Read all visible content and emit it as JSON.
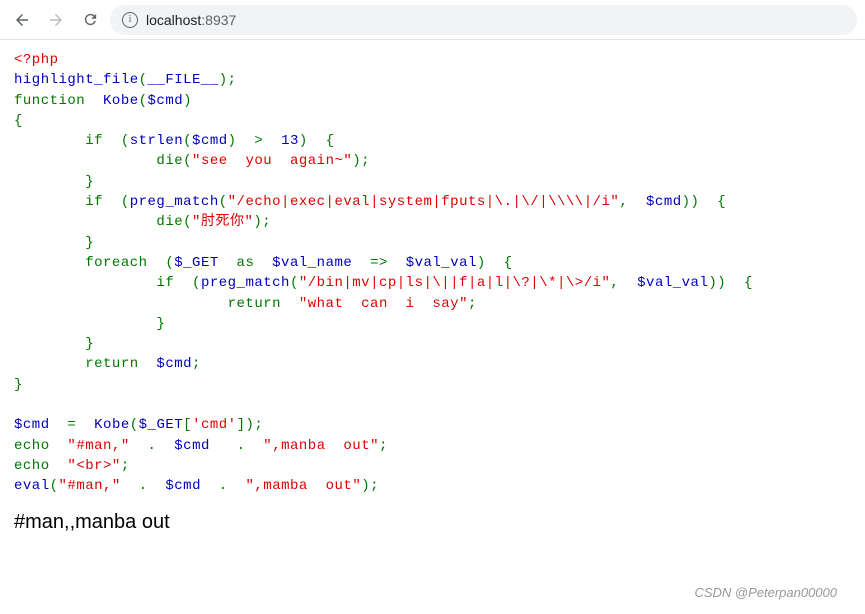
{
  "toolbar": {
    "url_host": "localhost",
    "url_port": ":8937"
  },
  "code": {
    "l1_open": "<?php",
    "l2_fn": "highlight_file",
    "l2_paren_o": "(",
    "l2_arg": "__FILE__",
    "l2_close": ");",
    "l3_func": "function  ",
    "l3_name": "Kobe",
    "l3_p": "(",
    "l3_arg": "$cmd",
    "l3_cp": ")",
    "l4_brace": "{",
    "l5_if": "        if  (",
    "l5_strlen": "strlen",
    "l5_po": "(",
    "l5_cmd": "$cmd",
    "l5_pc": ")  >  ",
    "l5_num": "13",
    "l5_end": ")  {",
    "l6_die": "                die",
    "l6_po": "(",
    "l6_str": "\"see  you  again~\"",
    "l6_pc": ");",
    "l7_brace": "        }",
    "l8_if": "        if  (",
    "l8_pm": "preg_match",
    "l8_po": "(",
    "l8_re": "\"/echo|exec|eval|system|fputs|\\.|\\/|\\\\\\\\|/i\"",
    "l8_comma": ",  ",
    "l8_cmd": "$cmd",
    "l8_pc": "))  {",
    "l9_die": "                die",
    "l9_po": "(",
    "l9_str": "\"肘死你\"",
    "l9_pc": ");",
    "l10_brace": "        }",
    "l11_fe": "        foreach  (",
    "l11_get": "$_GET  ",
    "l11_as": "as  ",
    "l11_vn": "$val_name  ",
    "l11_arrow": "=>  ",
    "l11_vv": "$val_val",
    "l11_end": ")  {",
    "l12_if": "                if  (",
    "l12_pm": "preg_match",
    "l12_po": "(",
    "l12_re": "\"/bin|mv|cp|ls|\\||f|a|l|\\?|\\*|\\>/i\"",
    "l12_comma": ",  ",
    "l12_vv": "$val_val",
    "l12_pc": "))  {",
    "l13_ret": "                        return  ",
    "l13_str": "\"what  can  i  say\"",
    "l13_semi": ";",
    "l14_brace": "                }",
    "l15_brace": "        }",
    "l16_ret": "        return  ",
    "l16_cmd": "$cmd",
    "l16_semi": ";",
    "l17_brace": "}",
    "l18_cmd": "$cmd  ",
    "l18_eq": "=  ",
    "l18_kobe": "Kobe",
    "l18_po": "(",
    "l18_get": "$_GET",
    "l18_br": "[",
    "l18_key": "'cmd'",
    "l18_brc": "]);",
    "l19_echo": "echo  ",
    "l19_s1": "\"#man,\"  ",
    "l19_dot1": ".  ",
    "l19_cmd": "$cmd   ",
    "l19_dot2": ".  ",
    "l19_s2": "\",manba  out\"",
    "l19_semi": ";",
    "l20_echo": "echo  ",
    "l20_br": "\"<br>\"",
    "l20_semi": ";",
    "l21_eval": "eval",
    "l21_po": "(",
    "l21_s1": "\"#man,\"  ",
    "l21_dot1": ".  ",
    "l21_cmd": "$cmd  ",
    "l21_dot2": ".  ",
    "l21_s2": "\",mamba  out\"",
    "l21_pc": ");"
  },
  "output": "#man,,manba out",
  "watermark": "CSDN @Peterpan00000"
}
